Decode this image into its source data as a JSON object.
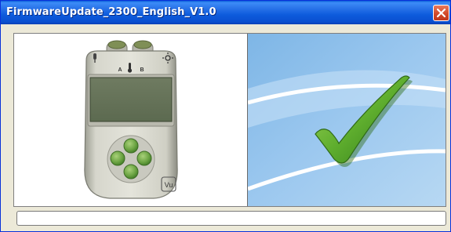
{
  "window": {
    "title": "FirmwareUpdate_2300_English_V1.0"
  },
  "device": {
    "port_a_label": "A",
    "port_b_label": "B",
    "logo_text": "Vu"
  },
  "status": {
    "result_icon": "checkmark-icon",
    "progress": 0
  },
  "colors": {
    "titlebar": "#0a5fd8",
    "checkmark": "#5fae2e",
    "sky": "#a9cfee"
  }
}
